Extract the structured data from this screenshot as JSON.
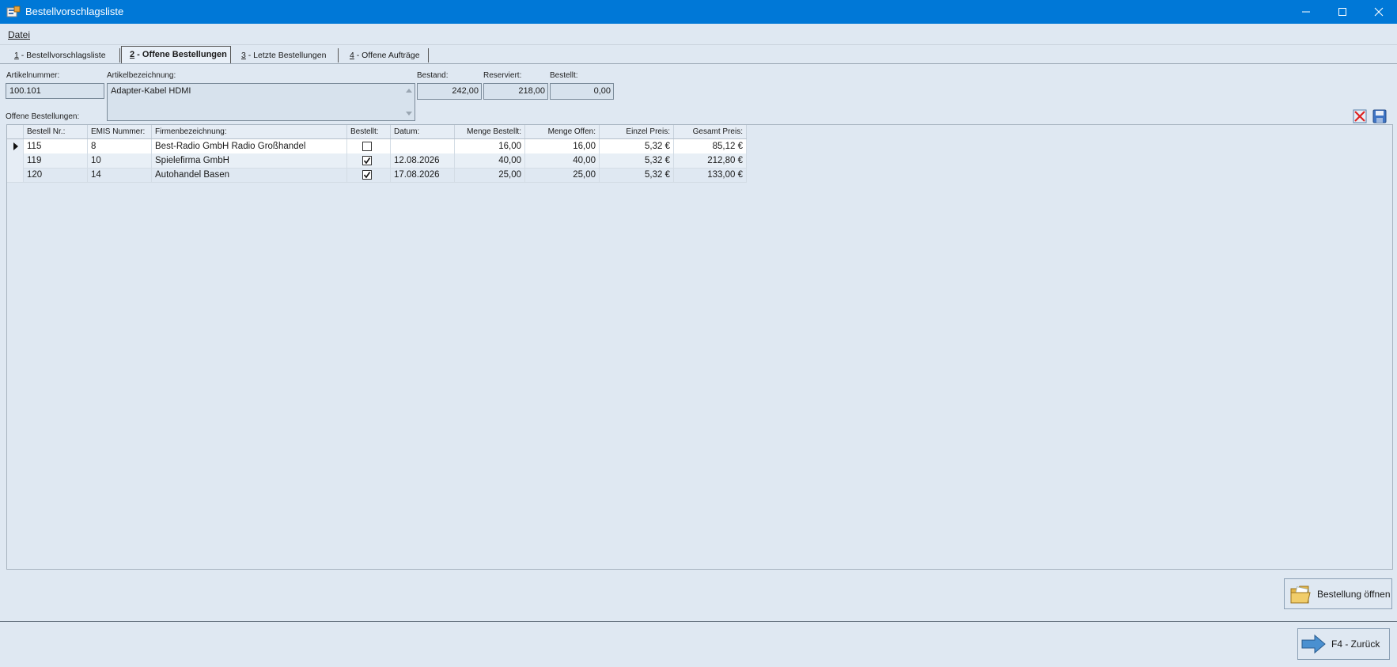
{
  "window": {
    "title": "Bestellvorschlagsliste"
  },
  "menu": {
    "datei": "Datei"
  },
  "tabs": [
    {
      "num": "1",
      "label": " - Bestellvorschlagsliste"
    },
    {
      "num": "2",
      "label": " - Offene Bestellungen"
    },
    {
      "num": "3",
      "label": " - Letzte Bestellungen"
    },
    {
      "num": "4",
      "label": " - Offene Aufträge"
    }
  ],
  "form": {
    "artikelnummer_label": "Artikelnummer:",
    "artikelnummer_value": "100.101",
    "artikelbezeichnung_label": "Artikelbezeichnung:",
    "artikelbezeichnung_value": "Adapter-Kabel HDMI",
    "bestand_label": "Bestand:",
    "bestand_value": "242,00",
    "reserviert_label": "Reserviert:",
    "reserviert_value": "218,00",
    "bestellt_label": "Bestellt:",
    "bestellt_value": "0,00",
    "offene_label": "Offene Bestellungen:"
  },
  "grid": {
    "columns": [
      "Bestell Nr.:",
      "EMIS Nummer:",
      "Firmenbezeichnung:",
      "Bestellt:",
      "Datum:",
      "Menge Bestellt:",
      "Menge Offen:",
      "Einzel Preis:",
      "Gesamt Preis:"
    ],
    "rows": [
      {
        "bestell_nr": "115",
        "emis": "8",
        "firma": "Best-Radio GmbH Radio Großhandel",
        "bestellt": false,
        "datum": "",
        "menge_bestellt": "16,00",
        "menge_offen": "16,00",
        "einzel": "5,32 €",
        "gesamt": "85,12 €"
      },
      {
        "bestell_nr": "119",
        "emis": "10",
        "firma": "Spielefirma GmbH",
        "bestellt": true,
        "datum": "12.08.2026",
        "menge_bestellt": "40,00",
        "menge_offen": "40,00",
        "einzel": "5,32 €",
        "gesamt": "212,80 €"
      },
      {
        "bestell_nr": "120",
        "emis": "14",
        "firma": "Autohandel Basen",
        "bestellt": true,
        "datum": "17.08.2026",
        "menge_bestellt": "25,00",
        "menge_offen": "25,00",
        "einzel": "5,32 €",
        "gesamt": "133,00 €"
      }
    ]
  },
  "buttons": {
    "bestellung_oeffnen": "Bestellung öffnen",
    "zurueck": "F4 - Zurück"
  },
  "icons": {
    "delete": "delete-x-icon",
    "save": "floppy-save-icon",
    "folder": "folder-icon",
    "arrow": "arrow-right-icon"
  },
  "colors": {
    "titlebar": "#0078d7",
    "background": "#dfe8f2"
  }
}
